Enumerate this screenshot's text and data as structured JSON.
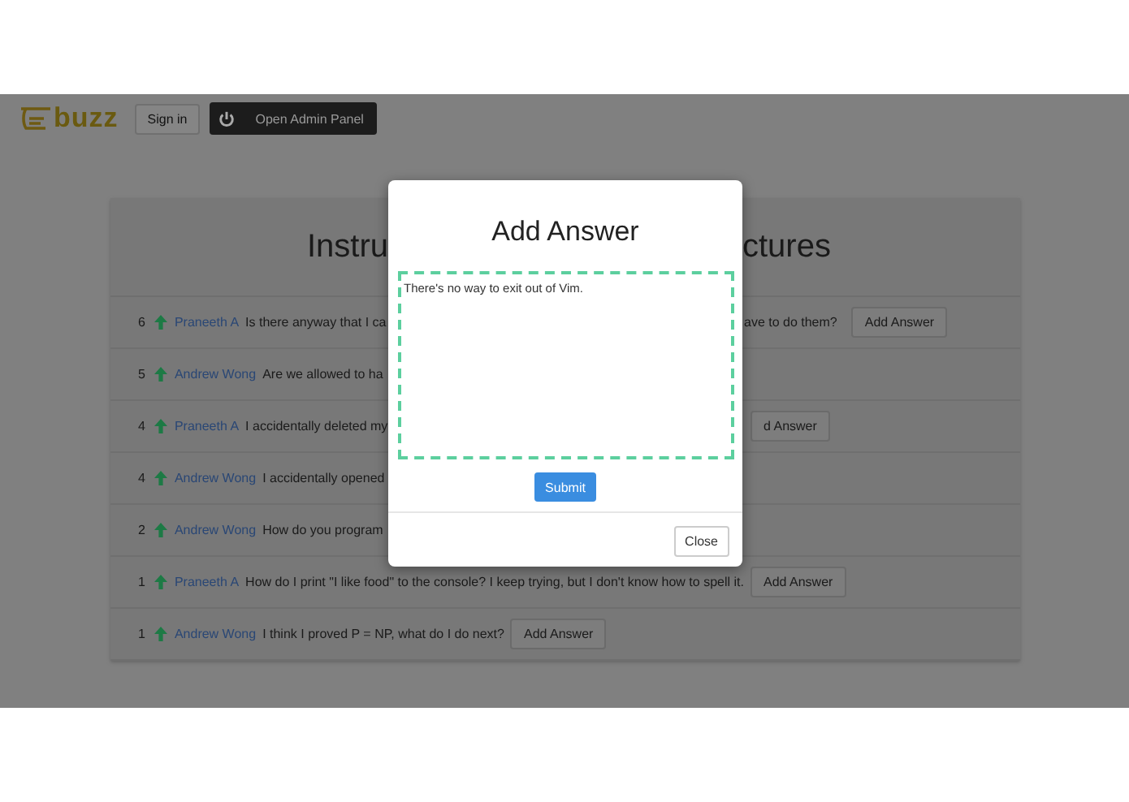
{
  "header": {
    "logo": "buzz",
    "sign_in": "Sign in",
    "admin_button": "Open Admin Panel"
  },
  "panel": {
    "title_left": "Instru",
    "title_right": "ctures"
  },
  "questions": [
    {
      "votes": "6",
      "author": "Praneeth A",
      "question": "Is there anyway that I ca",
      "question_tail": "ave to do them?",
      "tail_button": "Add Answer"
    },
    {
      "votes": "5",
      "author": "Andrew Wong",
      "question": "Are we allowed to ha"
    },
    {
      "votes": "4",
      "author": "Praneeth A",
      "question": "I accidentally deleted my",
      "tail_button": "d Answer"
    },
    {
      "votes": "4",
      "author": "Andrew Wong",
      "question": "I accidentally opened"
    },
    {
      "votes": "2",
      "author": "Andrew Wong",
      "question": "How do you program"
    },
    {
      "votes": "1",
      "author": "Praneeth A",
      "question": "How do I print \"I like food\" to the console? I keep trying, but I don't know how to spell it.",
      "button": "Add Answer"
    },
    {
      "votes": "1",
      "author": "Andrew Wong",
      "question": "I think I proved P = NP, what do I do next?",
      "button": "Add Answer"
    }
  ],
  "modal": {
    "title": "Add Answer",
    "answer": "There's no way to exit out of Vim.",
    "submit": "Submit",
    "close": "Close"
  }
}
